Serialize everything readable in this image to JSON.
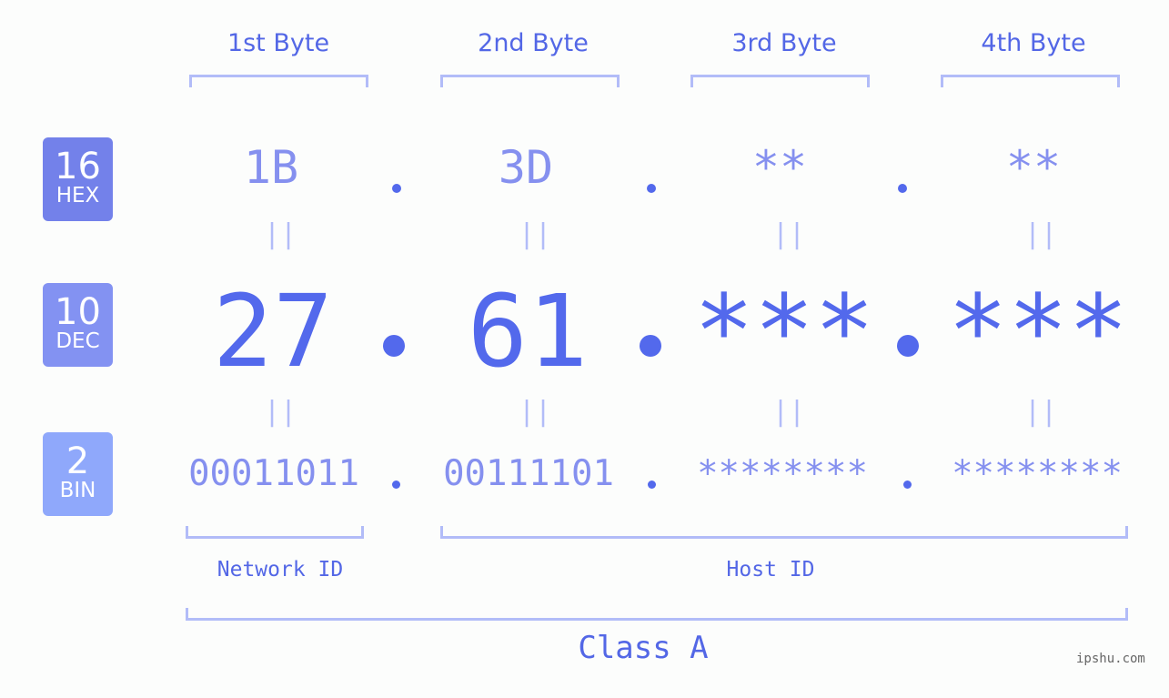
{
  "bytes": [
    {
      "label": "1st Byte",
      "hex": "1B",
      "dec": "27",
      "bin": "00011011"
    },
    {
      "label": "2nd Byte",
      "hex": "3D",
      "dec": "61",
      "bin": "00111101"
    },
    {
      "label": "3rd Byte",
      "hex": "**",
      "dec": "***",
      "bin": "********"
    },
    {
      "label": "4th Byte",
      "hex": "**",
      "dec": "***",
      "bin": "********"
    }
  ],
  "bases": [
    {
      "num": "16",
      "label": "HEX",
      "color": "#7381ea"
    },
    {
      "num": "10",
      "label": "DEC",
      "color": "#8392f2"
    },
    {
      "num": "2",
      "label": "BIN",
      "color": "#8fa8fb"
    }
  ],
  "equals_symbol": "||",
  "network_id_label": "Network ID",
  "host_id_label": "Host ID",
  "class_label": "Class A",
  "watermark": "ipshu.com"
}
